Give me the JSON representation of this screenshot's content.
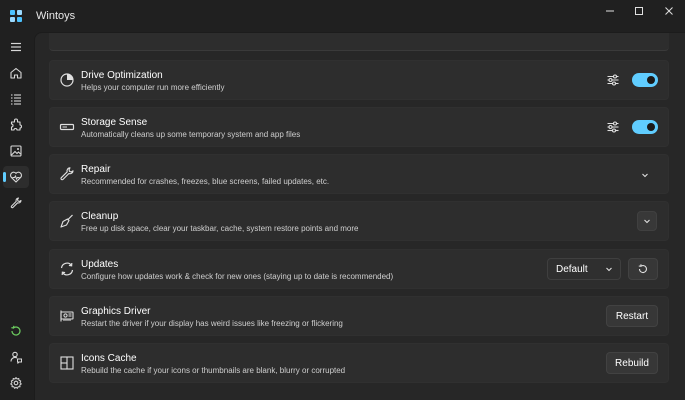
{
  "window": {
    "title": "Wintoys",
    "minimize_glyph": "—",
    "maximize_glyph": "☐",
    "close_glyph": "✕"
  },
  "colors": {
    "accent": "#60cdff",
    "background": "#202020",
    "card": "#2d2d2d"
  },
  "sidebar": {
    "items": [
      {
        "icon": "hamburger-menu-icon"
      },
      {
        "icon": "home-icon"
      },
      {
        "icon": "apps-list-icon"
      },
      {
        "icon": "puzzle-icon"
      },
      {
        "icon": "image-icon"
      },
      {
        "icon": "health-icon",
        "active": true
      },
      {
        "icon": "tools-icon"
      }
    ],
    "bottom_items": [
      {
        "icon": "restore-icon"
      },
      {
        "icon": "feedback-icon"
      },
      {
        "icon": "gear-icon"
      }
    ]
  },
  "cards": [
    {
      "title": "Drive Optimization",
      "desc": "Helps your computer run more efficiently",
      "icon": "drive-optimization-icon",
      "toggle": true
    },
    {
      "title": "Storage Sense",
      "desc": "Automatically cleans up some temporary system and app files",
      "icon": "storage-icon",
      "toggle": true
    },
    {
      "title": "Repair",
      "desc": "Recommended for crashes, freezes, blue screens, failed updates, etc.",
      "icon": "wrench-icon"
    },
    {
      "title": "Cleanup",
      "desc": "Free up disk space, clear your taskbar, cache, system restore points and more",
      "icon": "broom-icon"
    },
    {
      "title": "Updates",
      "desc": "Configure how updates work & check for new ones (staying up to date is recommended)",
      "icon": "sync-icon",
      "select_value": "Default"
    },
    {
      "title": "Graphics Driver",
      "desc": "Restart the driver if your display has weird issues like freezing or flickering",
      "icon": "graphics-card-icon",
      "button_label": "Restart"
    },
    {
      "title": "Icons Cache",
      "desc": "Rebuild the cache if your icons or thumbnails are blank, blurry or corrupted",
      "icon": "grid-icon",
      "button_label": "Rebuild"
    }
  ]
}
